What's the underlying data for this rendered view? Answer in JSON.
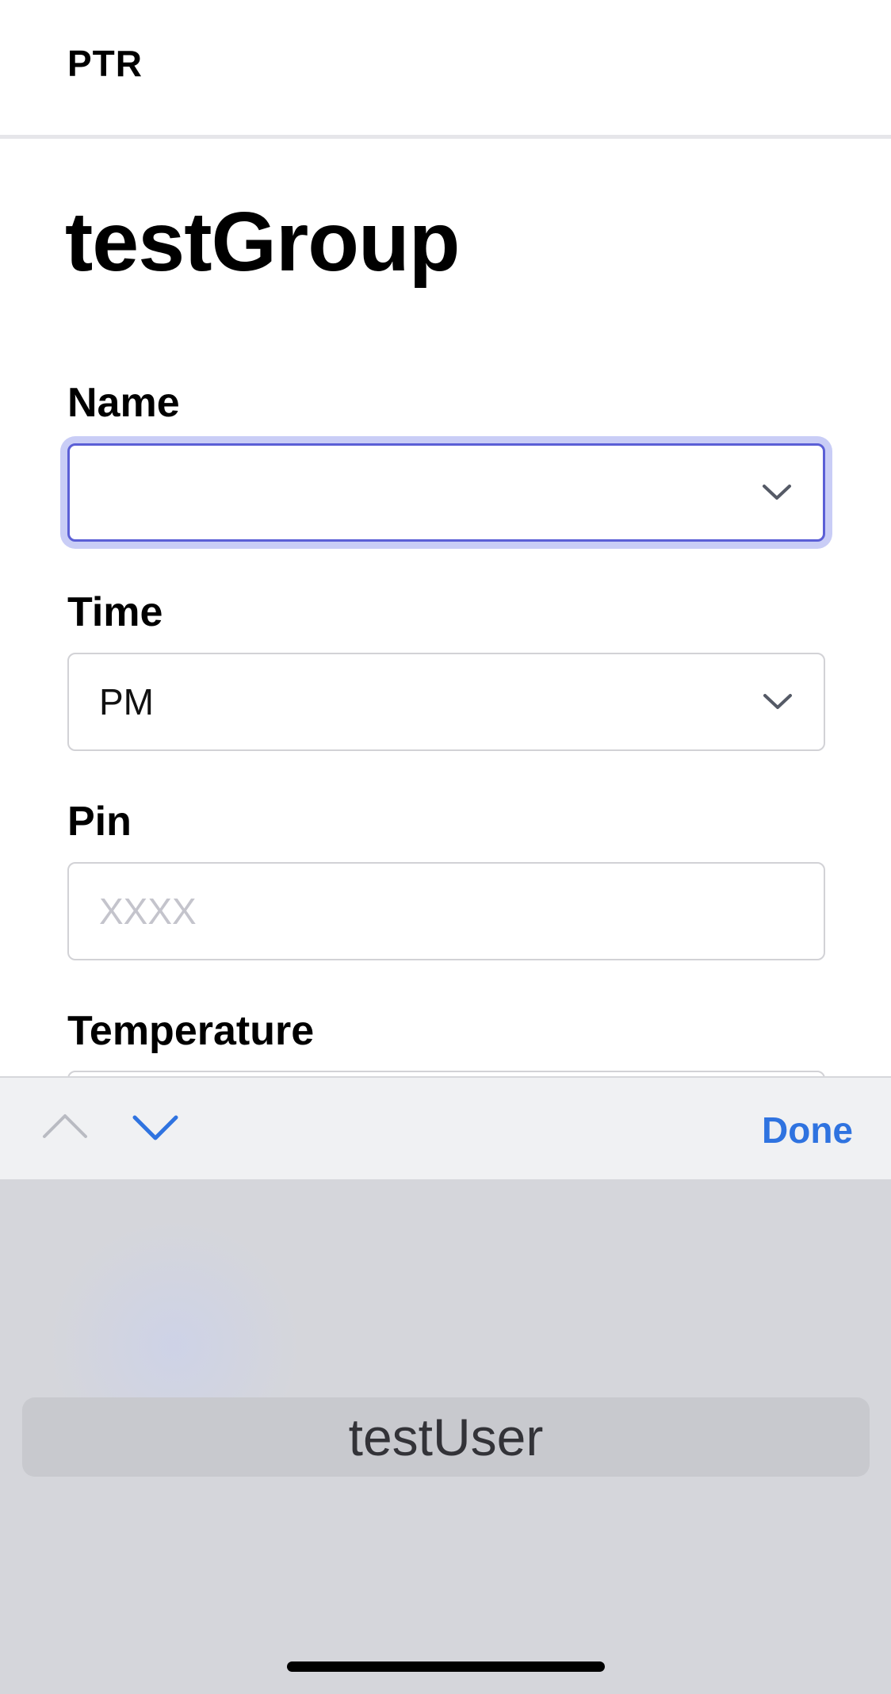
{
  "header": {
    "brand": "PTR"
  },
  "page": {
    "title": "testGroup"
  },
  "form": {
    "name": {
      "label": "Name",
      "value": "",
      "icon": "chevron-down-icon"
    },
    "time": {
      "label": "Time",
      "value": "PM",
      "icon": "chevron-down-icon"
    },
    "pin": {
      "label": "Pin",
      "placeholder": "XXXX",
      "value": ""
    },
    "temperature": {
      "label": "Temperature"
    }
  },
  "keyboard_accessory": {
    "prev_icon": "chevron-up-icon",
    "next_icon": "chevron-down-icon",
    "done_label": "Done",
    "done_color": "#2f73e0"
  },
  "picker": {
    "options": [
      "testUser"
    ]
  },
  "colors": {
    "focus_border": "#5b5fd6",
    "focus_ring": "#c9cdf6",
    "accent": "#2f73e0"
  }
}
